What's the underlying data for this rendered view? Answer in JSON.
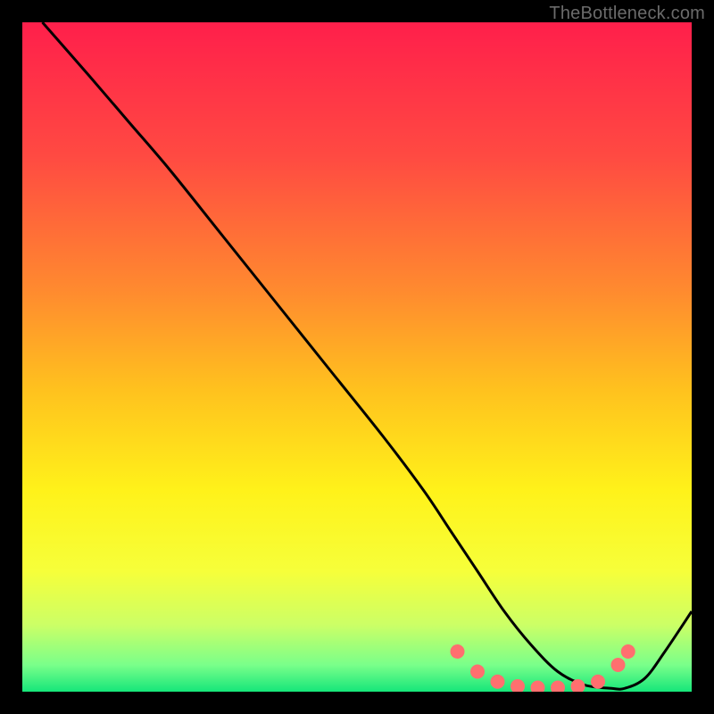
{
  "watermark": "TheBottleneck.com",
  "chart_data": {
    "type": "line",
    "title": "",
    "xlabel": "",
    "ylabel": "",
    "xlim": [
      0,
      100
    ],
    "ylim": [
      0,
      100
    ],
    "gradient_stops": [
      {
        "offset": 0.0,
        "color": "#ff1f4b"
      },
      {
        "offset": 0.2,
        "color": "#ff4a42"
      },
      {
        "offset": 0.4,
        "color": "#ff8a2f"
      },
      {
        "offset": 0.55,
        "color": "#ffc21e"
      },
      {
        "offset": 0.7,
        "color": "#fff21a"
      },
      {
        "offset": 0.82,
        "color": "#f6ff3a"
      },
      {
        "offset": 0.9,
        "color": "#ccff66"
      },
      {
        "offset": 0.96,
        "color": "#7aff8a"
      },
      {
        "offset": 1.0,
        "color": "#16e67a"
      }
    ],
    "series": [
      {
        "name": "bottleneck-curve",
        "x": [
          3,
          10,
          16,
          22,
          30,
          38,
          46,
          54,
          60,
          64,
          68,
          72,
          76,
          80,
          84,
          88,
          90,
          93,
          96,
          100
        ],
        "y": [
          100,
          92,
          85,
          78,
          68,
          58,
          48,
          38,
          30,
          24,
          18,
          12,
          7,
          3,
          1,
          0.5,
          0.5,
          2,
          6,
          12
        ]
      }
    ],
    "markers": {
      "color": "#ff6f6f",
      "radius_px": 8,
      "points": [
        {
          "x": 65,
          "y": 6
        },
        {
          "x": 68,
          "y": 3
        },
        {
          "x": 71,
          "y": 1.5
        },
        {
          "x": 74,
          "y": 0.8
        },
        {
          "x": 77,
          "y": 0.6
        },
        {
          "x": 80,
          "y": 0.6
        },
        {
          "x": 83,
          "y": 0.8
        },
        {
          "x": 86,
          "y": 1.5
        },
        {
          "x": 89,
          "y": 4
        },
        {
          "x": 90.5,
          "y": 6
        }
      ]
    }
  }
}
